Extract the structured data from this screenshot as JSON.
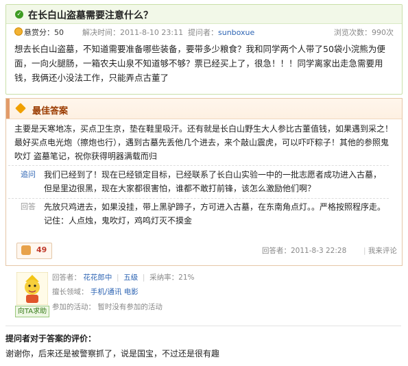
{
  "question": {
    "title": "在长白山盗墓需要注意什么？",
    "reward": "悬赏分：50",
    "resolved_time": "解决时间：2011-8-10 23:11",
    "asker_label": "提问者：",
    "asker_name": "sunboxue",
    "views": "浏览次数：990次",
    "body": "想去长白山盗墓，不知道需要准备哪些装备，要带多少粮食？我和同学两个人带了50袋小浣熊为便面，一向火腿肠，一箱农夫山泉不知道够不够？票已经买上了，很急！！！同学离家出走急需要用钱，我俩还小没法工作，只能弄点古董了"
  },
  "best_answer": {
    "header": "最佳答案",
    "body": "主要是天寒地冻，买点卫生京，垫在鞋里吸汗。还有就是长白山野生大人参比古董值钱，如果遇到采之！最好买点电光炮（擦炮也行），遇到古墓先丢他几个进去，来个敲山震虎，可以吓吓粽子！其他的参照鬼吹灯 盗墓笔记，祝你获得明器满载而归",
    "followups": [
      {
        "label": "追问",
        "text": "我们已经到了！现在已经锁定目标，已经联系了长白山实验一中的一批志愿者成功进入古墓，但是里边很黑，现在大家都很害怕，谁都不敢打前锋，该怎么激励他们啊？"
      },
      {
        "label": "回答",
        "text": "先放只鸡进去，如果没挂，带上黑驴蹄子，方可进入古墓，在东南角点灯。。严格按照程序走。记住：人点烛，鬼吹灯，鸡鸣灯灭不摸金"
      }
    ],
    "likes": "49",
    "answer_time": "回答者：2011-8-3 22:28",
    "comment_link": "我来评论"
  },
  "answerer": {
    "ask_button": "向TA求助",
    "label_name": "回答者：",
    "name": "花花郎中",
    "level": "五级",
    "adoption": "采纳率：21%",
    "expertise_label": "擅长领域：",
    "expertise": "手机/通讯 电影",
    "activity_label": "参加的活动：",
    "activity": "暂时没有参加的活动"
  },
  "evaluation": {
    "header": "提问者对于答案的评价：",
    "body": "谢谢你，后来还是被警察抓了，说是国宝，不过还是很有趣"
  },
  "colors": {
    "link": "#2d64b3",
    "green": "#3d9b22",
    "orange_header": "#9a3b00"
  }
}
